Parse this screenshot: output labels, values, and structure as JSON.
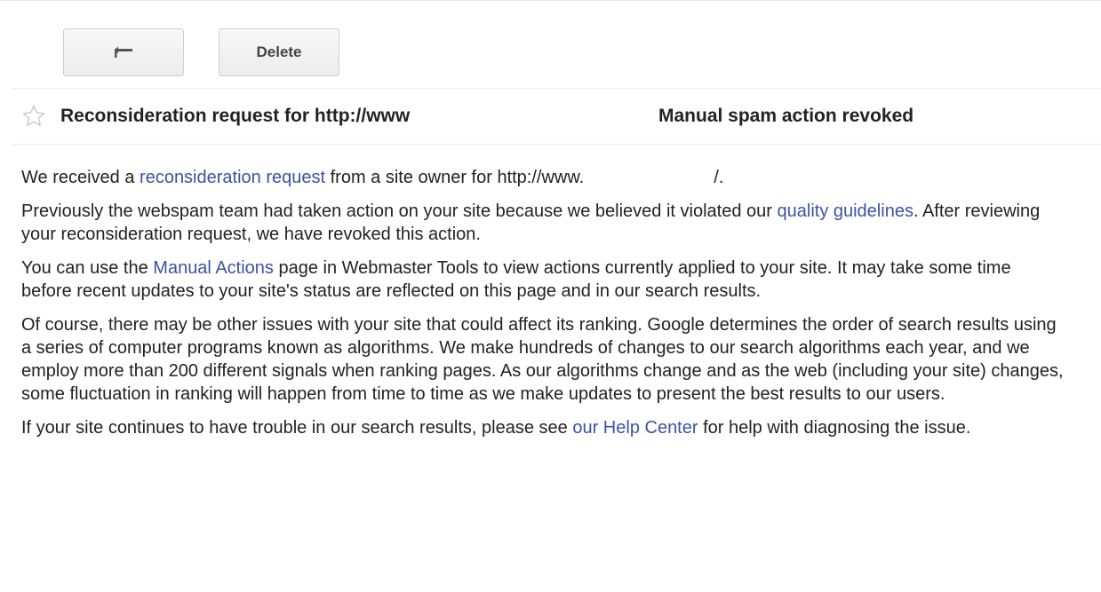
{
  "toolbar": {
    "back_icon": "back-arrow-icon",
    "delete_label": "Delete"
  },
  "message": {
    "star_icon": "star-outline-icon",
    "subject": "Reconsideration request for http://www",
    "status": "Manual spam action revoked"
  },
  "body": {
    "p1": {
      "before": "We received a ",
      "link": "reconsideration request",
      "after_a": " from a site owner for http://www.",
      "after_b": "/."
    },
    "p2": {
      "before": "Previously the webspam team had taken action on your site because we believed it violated our ",
      "link": "quality guidelines",
      "after": ". After reviewing your reconsideration request, we have revoked this action."
    },
    "p3": {
      "before": "You can use the ",
      "link": "Manual Actions",
      "after": " page in Webmaster Tools to view actions currently applied to your site. It may take some time before recent updates to your site's status are reflected on this page and in our search results."
    },
    "p4": {
      "text": "Of course, there may be other issues with your site that could affect its ranking. Google determines the order of search results using a series of computer programs known as algorithms. We make hundreds of changes to our search algorithms each year, and we employ more than 200 different signals when ranking pages. As our algorithms change and as the web (including your site) changes, some fluctuation in ranking will happen from time to time as we make updates to present the best results to our users."
    },
    "p5": {
      "before": "If your site continues to have trouble in our search results, please see ",
      "link": "our Help Center",
      "after": " for help with diagnosing the issue."
    }
  },
  "colors": {
    "link": "#3b53a4",
    "text": "#222222",
    "divider": "#ebebeb"
  }
}
